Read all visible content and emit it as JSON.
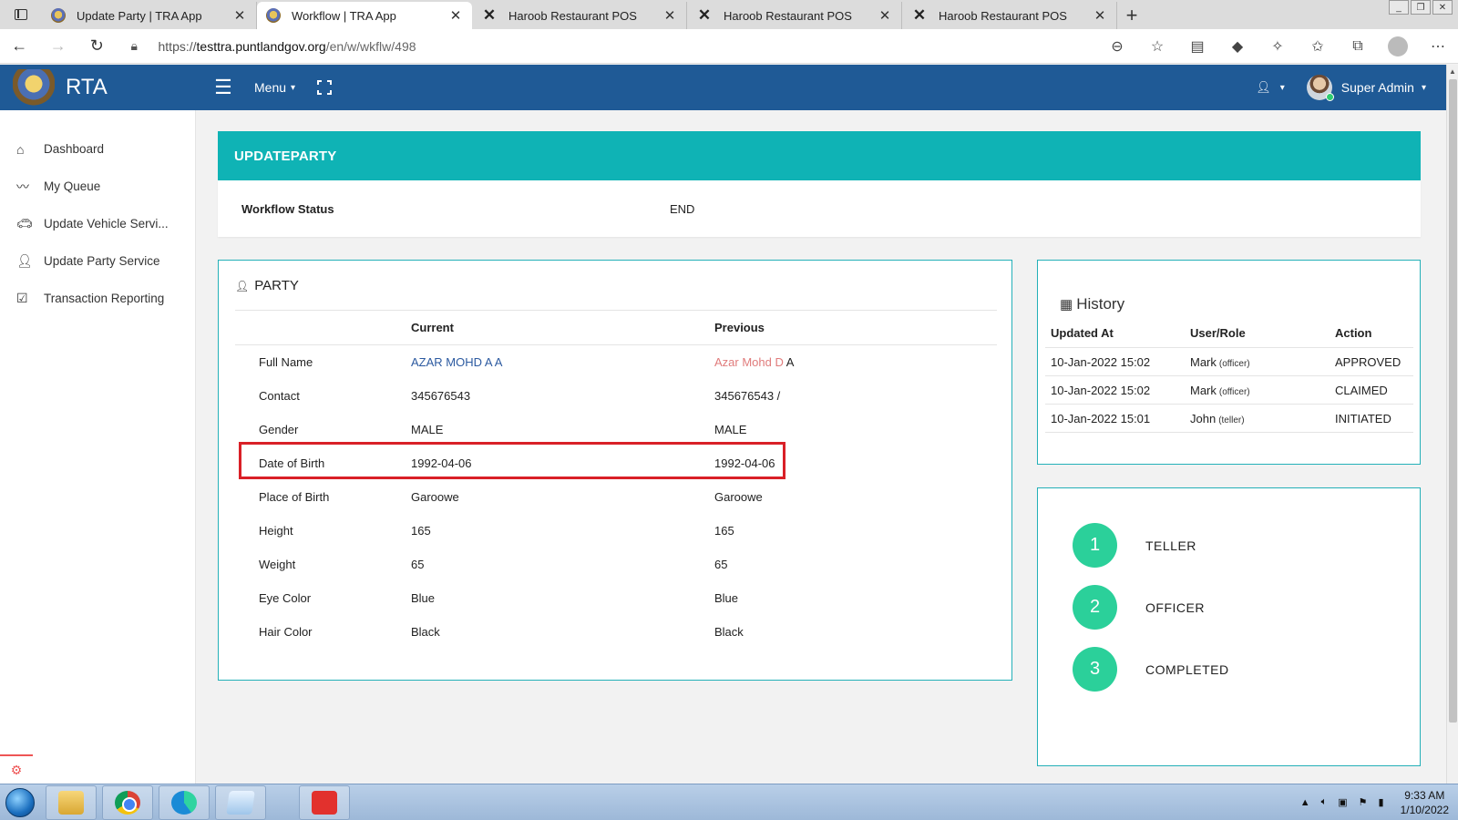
{
  "browser": {
    "tabs": [
      {
        "title": "Update Party | TRA App",
        "favicon": "emblem-icon",
        "active": false
      },
      {
        "title": "Workflow | TRA App",
        "favicon": "emblem-icon",
        "active": true
      },
      {
        "title": "Haroob Restaurant POS",
        "favicon": "x-icon",
        "active": false
      },
      {
        "title": "Haroob Restaurant POS",
        "favicon": "x-icon",
        "active": false
      },
      {
        "title": "Haroob Restaurant POS",
        "favicon": "x-icon",
        "active": false
      }
    ],
    "url": {
      "scheme": "https://",
      "domain": "testtra.puntlandgov.org",
      "path": "/en/w/wkflw/498"
    }
  },
  "app": {
    "brand": "RTA",
    "menu_label": "Menu",
    "user_name": "Super Admin"
  },
  "sidebar": {
    "items": [
      {
        "label": "Dashboard",
        "icon": "home-icon"
      },
      {
        "label": "My Queue",
        "icon": "trend-icon"
      },
      {
        "label": "Update Vehicle Servi...",
        "icon": "car-icon"
      },
      {
        "label": "Update Party Service",
        "icon": "user-icon"
      },
      {
        "label": "Transaction Reporting",
        "icon": "check-square-icon"
      }
    ]
  },
  "workflow": {
    "title": "UPDATEPARTY",
    "status_label": "Workflow Status",
    "status_value": "END"
  },
  "party": {
    "title": "PARTY",
    "headers": {
      "current": "Current",
      "previous": "Previous"
    },
    "rows": [
      {
        "label": "Full Name",
        "current": "AZAR MOHD A A",
        "previous_changed": "Azar Mohd D",
        "previous_rest": " A"
      },
      {
        "label": "Contact",
        "current": "345676543",
        "previous": "345676543 /"
      },
      {
        "label": "Gender",
        "current": "MALE",
        "previous": "MALE"
      },
      {
        "label": "Date of Birth",
        "current": "1992-04-06",
        "previous": "1992-04-06"
      },
      {
        "label": "Place of Birth",
        "current": "Garoowe",
        "previous": "Garoowe"
      },
      {
        "label": "Height",
        "current": "165",
        "previous": "165"
      },
      {
        "label": "Weight",
        "current": "65",
        "previous": "65"
      },
      {
        "label": "Eye Color",
        "current": "Blue",
        "previous": "Blue"
      },
      {
        "label": "Hair Color",
        "current": "Black",
        "previous": "Black"
      }
    ]
  },
  "history": {
    "title": "History",
    "headers": {
      "updated_at": "Updated At",
      "user_role": "User/Role",
      "action": "Action"
    },
    "rows": [
      {
        "updated_at": "10-Jan-2022 15:02",
        "user": "Mark",
        "role": "(officer)",
        "action": "APPROVED"
      },
      {
        "updated_at": "10-Jan-2022 15:02",
        "user": "Mark",
        "role": "(officer)",
        "action": "CLAIMED"
      },
      {
        "updated_at": "10-Jan-2022 15:01",
        "user": "John",
        "role": "(teller)",
        "action": "INITIATED"
      }
    ]
  },
  "steps": [
    {
      "number": "1",
      "label": "TELLER"
    },
    {
      "number": "2",
      "label": "OFFICER"
    },
    {
      "number": "3",
      "label": "COMPLETED"
    }
  ],
  "taskbar": {
    "time": "9:33 AM",
    "date": "1/10/2022"
  },
  "colors": {
    "header_blue": "#1f5a96",
    "teal": "#0fb3b5",
    "step_green": "#2bd09a",
    "highlight_red": "#d92027",
    "changed_current": "#2c5aa0",
    "changed_previous": "#e07b7b"
  }
}
